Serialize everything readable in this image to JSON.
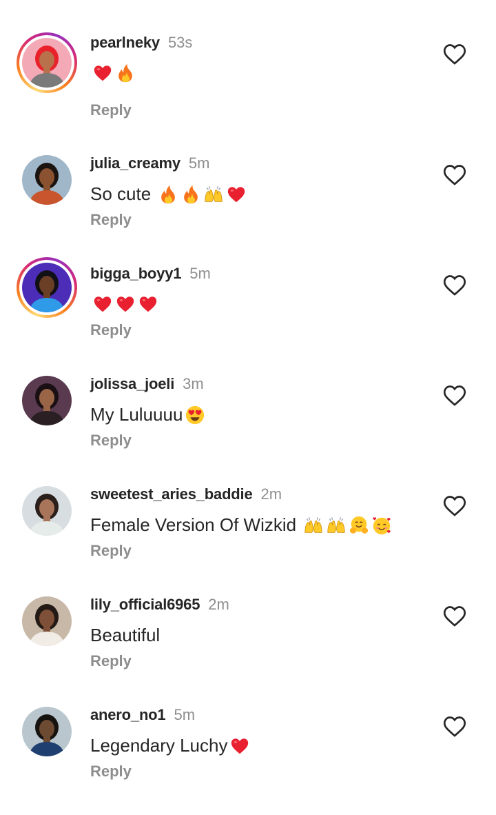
{
  "icons": {
    "like": "heart-outline-icon"
  },
  "comments": [
    {
      "username": "pearlneky",
      "time": "53s",
      "text": "",
      "emojis": [
        "red-heart",
        "fire"
      ],
      "reply": "Reply",
      "story_ring": true,
      "avatar": {
        "bg": "#f4a9b6",
        "hair": "#e8212a",
        "skin": "#b9714b",
        "top": "#7a7a7a"
      }
    },
    {
      "username": "julia_creamy",
      "time": "5m",
      "text": "So cute ",
      "emojis": [
        "fire",
        "fire",
        "raising-hands",
        "red-heart"
      ],
      "reply": "Reply",
      "story_ring": false,
      "avatar": {
        "bg": "#9fb7c9",
        "hair": "#1b1410",
        "skin": "#8a5230",
        "top": "#c8552d"
      }
    },
    {
      "username": "bigga_boyy1",
      "time": "5m",
      "text": "",
      "emojis": [
        "red-heart",
        "red-heart",
        "red-heart"
      ],
      "reply": "Reply",
      "story_ring": true,
      "avatar": {
        "bg": "#4b2db8",
        "hair": "#101016",
        "skin": "#6b3f26",
        "top": "#2f9be8"
      }
    },
    {
      "username": "jolissa_joeli",
      "time": "3m",
      "text": "My Luluuuu",
      "emojis": [
        "heart-eyes"
      ],
      "reply": "Reply",
      "story_ring": false,
      "avatar": {
        "bg": "#5a3a4f",
        "hair": "#1a1014",
        "skin": "#9a6547",
        "top": "#2a2024"
      }
    },
    {
      "username": "sweetest_aries_baddie",
      "time": "2m",
      "text": "Female Version Of Wizkid ",
      "emojis": [
        "raising-hands",
        "raising-hands",
        "hugging-face",
        "smiling-hearts"
      ],
      "reply": "Reply",
      "story_ring": false,
      "avatar": {
        "bg": "#d7dde0",
        "hair": "#2a1f1a",
        "skin": "#a8755a",
        "top": "#e6ece9"
      }
    },
    {
      "username": "lily_official6965",
      "time": "2m",
      "text": "Beautiful",
      "emojis": [],
      "reply": "Reply",
      "story_ring": false,
      "avatar": {
        "bg": "#c7b8a8",
        "hair": "#231a16",
        "skin": "#7e5038",
        "top": "#f1ece6"
      }
    },
    {
      "username": "anero_no1",
      "time": "5m",
      "text": "Legendary Luchy",
      "emojis": [
        "red-heart"
      ],
      "reply": "Reply",
      "story_ring": false,
      "avatar": {
        "bg": "#b9c6cd",
        "hair": "#16120f",
        "skin": "#6d4a32",
        "top": "#1f3f70"
      }
    }
  ]
}
